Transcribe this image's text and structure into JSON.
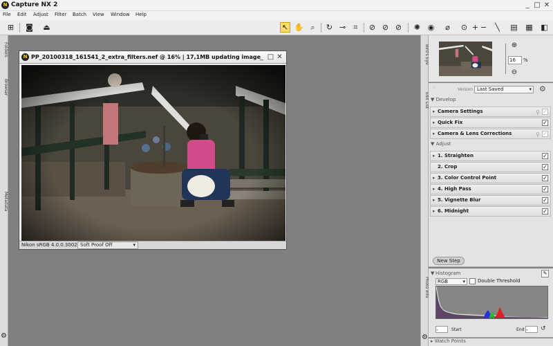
{
  "app": {
    "title": "Capture NX 2",
    "logo_glyph": "N"
  },
  "window_controls": {
    "minimize": "_",
    "maximize": "□",
    "close": "✕"
  },
  "menu": [
    "File",
    "Edit",
    "Adjust",
    "Filter",
    "Batch",
    "View",
    "Window",
    "Help"
  ],
  "toolbar": {
    "left_tools": [
      "browser-toggle-icon",
      "camera-icon",
      "tray-icon"
    ],
    "right_tools": [
      "direct-select-icon",
      "hand-icon",
      "zoom-icon",
      "rotate-icon",
      "straighten-icon",
      "crop-icon",
      "black-point-icon",
      "neutral-point-icon",
      "white-point-icon",
      "red-eye-icon",
      "auto-retouch-icon",
      "lasso-icon",
      "color-control-point-icon",
      "plus-point-icon",
      "minus-point-icon",
      "brush-icon",
      "gradient-icon",
      "fill-icon",
      "levels-icon"
    ]
  },
  "left_dock": {
    "tabs": [
      "Folders",
      "Browser",
      "Metadata"
    ]
  },
  "document": {
    "title": "PP_20100318_161541_2_extra_filters.nef @ 16% | 17,1MB updating image",
    "profile": "Nikon sRGB 4.0.0.3002",
    "softproof": "Soft Proof Off",
    "softproof_arrow": "▾"
  },
  "right_dock": {
    "tabs": [
      "Bird's Eye",
      "Edit List",
      "Photo Info"
    ]
  },
  "birds_eye": {
    "zoom_value": "16",
    "zoom_unit": "%"
  },
  "edit_list": {
    "version_label": "Version",
    "version_value": "Last Saved",
    "develop_title": "Develop",
    "develop_items": [
      {
        "label": "Camera Settings",
        "checked": true,
        "enabled": false,
        "link": true
      },
      {
        "label": "Quick Fix",
        "checked": true,
        "enabled": true,
        "link": false
      },
      {
        "label": "Camera & Lens Corrections",
        "checked": true,
        "enabled": false,
        "link": true
      }
    ],
    "adjust_title": "Adjust",
    "adjust_items": [
      {
        "label": "1. Straighten",
        "checked": true
      },
      {
        "label": "2. Crop",
        "checked": true
      },
      {
        "label": "3. Color Control Point",
        "checked": true
      },
      {
        "label": "4. High Pass",
        "checked": true
      },
      {
        "label": "5. Vignette Blur",
        "checked": true
      },
      {
        "label": "6. Midnight",
        "checked": true
      }
    ],
    "new_step": "New Step"
  },
  "histogram": {
    "title": "Histogram",
    "channel": "RGB",
    "double_threshold": "Double Threshold",
    "start_label": "Start",
    "end_label": "End",
    "start_value": "-",
    "end_value": "-"
  },
  "watch_points": {
    "title": "Watch Points"
  }
}
